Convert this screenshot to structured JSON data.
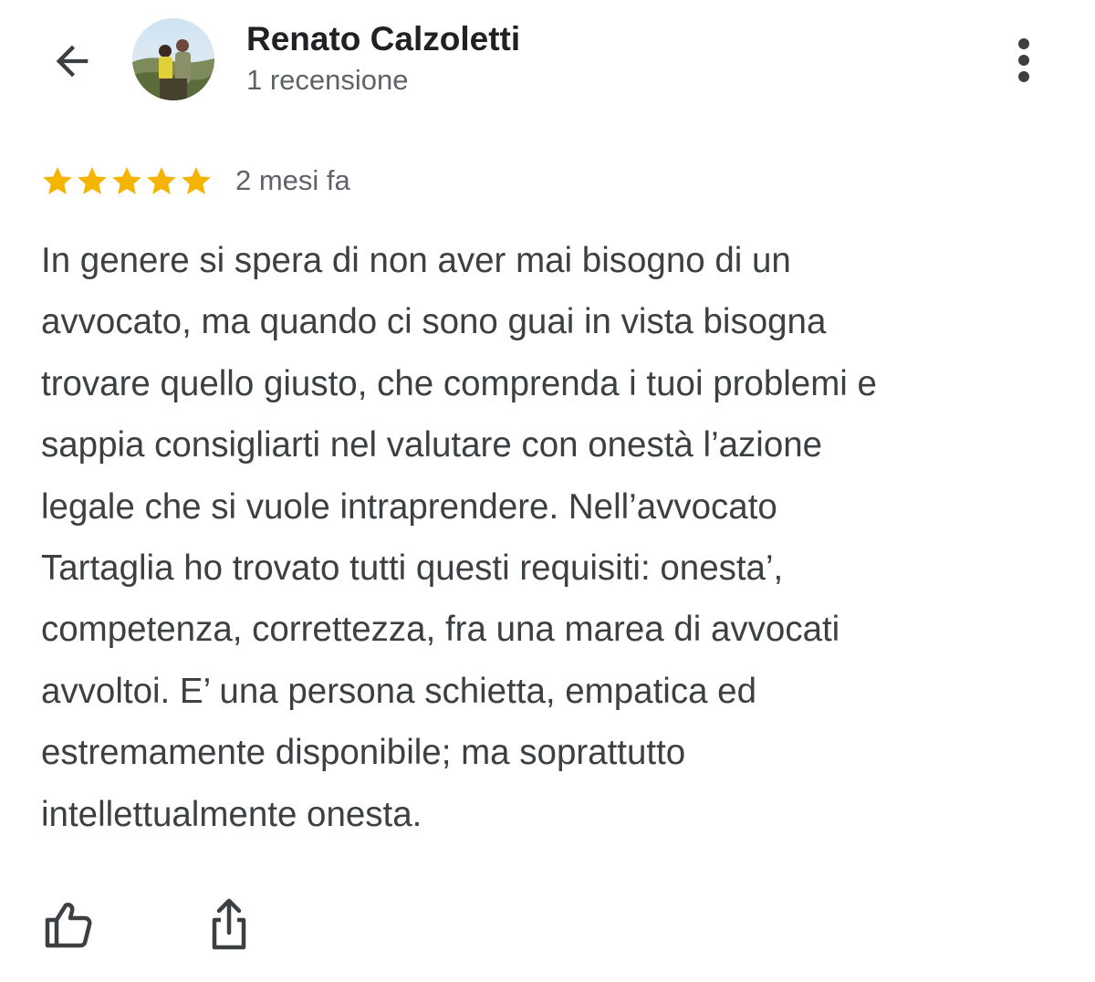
{
  "header": {
    "back_icon": "arrow-back-icon",
    "author_name": "Renato Calzoletti",
    "review_count": "1 recensione",
    "more_icon": "more-vert-icon"
  },
  "review": {
    "rating": 5,
    "rating_max": 5,
    "star_color": "#f4b400",
    "time": "2 mesi fa",
    "text_lines": [
      "In genere si spera di non aver mai bisogno di un",
      "avvocato, ma quando ci sono guai in vista bisogna",
      "trovare quello giusto, che comprenda i tuoi problemi e",
      "sappia consigliarti nel valutare con onestà l’azione",
      "legale che si vuole intraprendere. Nell’avvocato",
      "Tartaglia ho trovato tutti questi requisiti: onesta’,",
      "competenza, correttezza, fra una marea di avvocati",
      "avvoltoi. E’ una persona schietta, empatica ed",
      "estremamente disponibile; ma soprattutto",
      "intellettualmente onesta."
    ]
  },
  "actions": {
    "like_icon": "thumb-up-icon",
    "share_icon": "share-icon"
  }
}
